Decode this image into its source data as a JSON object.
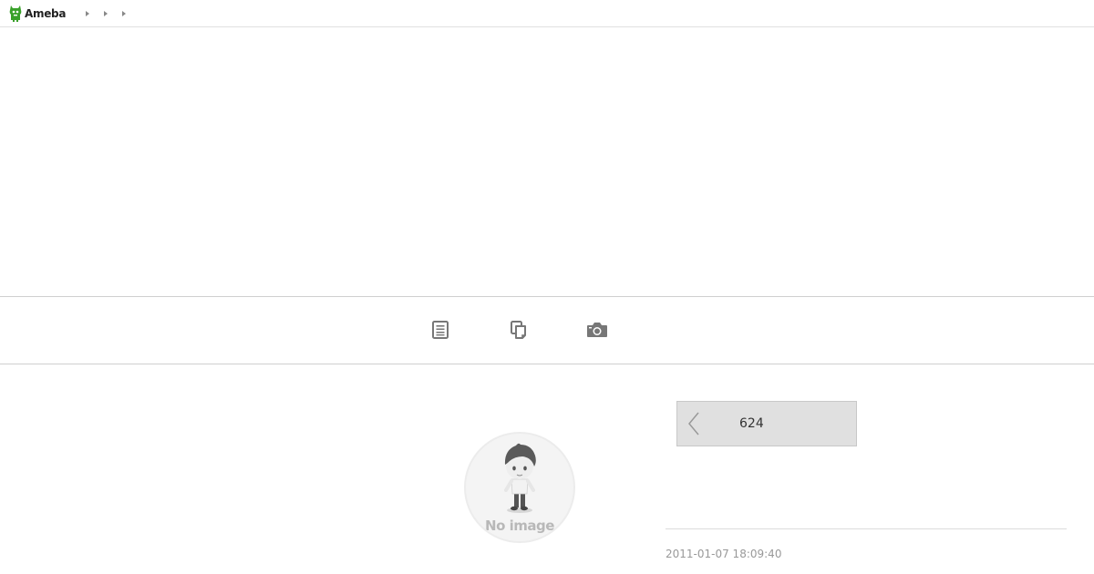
{
  "header": {
    "logo_text": "Ameba",
    "brand_color": "#3aa12b",
    "breadcrumb": [
      {
        "icon": "chevron-right-icon"
      },
      {
        "icon": "chevron-right-icon"
      },
      {
        "icon": "chevron-right-icon"
      }
    ]
  },
  "toolbar": {
    "buttons": [
      {
        "icon": "document-icon"
      },
      {
        "icon": "copy-icon"
      },
      {
        "icon": "camera-icon"
      }
    ]
  },
  "profile": {
    "no_image_label": "No image",
    "icon": "avatar-placeholder-icon"
  },
  "pager": {
    "prev_icon": "chevron-left-icon",
    "count": "624"
  },
  "entry": {
    "timestamp": "2011-01-07 18:09:40"
  }
}
